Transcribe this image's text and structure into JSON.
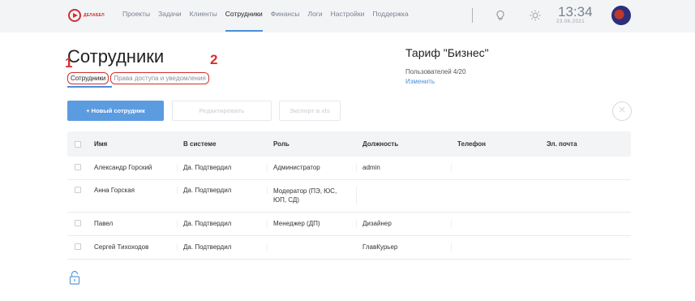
{
  "app": {
    "logo_text": "ДЕЛАБЕЛ"
  },
  "nav": {
    "items": [
      "Проекты",
      "Задачи",
      "Клиенты",
      "Сотрудники",
      "Финансы",
      "Логи",
      "Настройки",
      "Поддержка"
    ],
    "active": "Сотрудники"
  },
  "clock": {
    "time": "13:34",
    "date": "23.06.2021"
  },
  "page": {
    "title": "Сотрудники",
    "marks": [
      "1",
      "2"
    ],
    "subtabs": [
      "Сотрудники",
      "Права доступа и уведомления"
    ]
  },
  "tariff": {
    "title": "Тариф \"Бизнес\"",
    "users": "Пользователей 4/20",
    "change": "Изменить"
  },
  "toolbar": {
    "new_label": "+  Новый сотрудник",
    "edit_label": "Редактировать",
    "export_label": "Экспорт в xls",
    "close_glyph": "×"
  },
  "table": {
    "columns": [
      "Имя",
      "В системе",
      "Роль",
      "Должность",
      "Телефон",
      "Эл. почта"
    ],
    "rows": [
      {
        "name": "Александр Горский",
        "in_system": "Да. Подтвердил",
        "role": "Администратор",
        "position": "admin",
        "phone": "",
        "email": ""
      },
      {
        "name": "Анна Горская",
        "in_system": "Да. Подтвердил",
        "role": "Модератор (ПЭ, ЮС, ЮП, СД)",
        "position": "",
        "phone": "",
        "email": ""
      },
      {
        "name": "Павел",
        "in_system": "Да. Подтвердил",
        "role": "Менеджер (ДП)",
        "position": "Дизайнер",
        "phone": "",
        "email": ""
      },
      {
        "name": "Сергей Тихоходов",
        "in_system": "Да. Подтвердил",
        "role": "",
        "position": "ГлавКурьер",
        "phone": "",
        "email": ""
      }
    ]
  },
  "colors": {
    "accent": "#4a90d9",
    "primary_button": "#5b9be0",
    "annotation": "#d32f2f"
  },
  "icons": [
    "logo-icon",
    "lightbulb-icon",
    "sun-icon",
    "avatar",
    "close-icon",
    "lock-icon"
  ]
}
